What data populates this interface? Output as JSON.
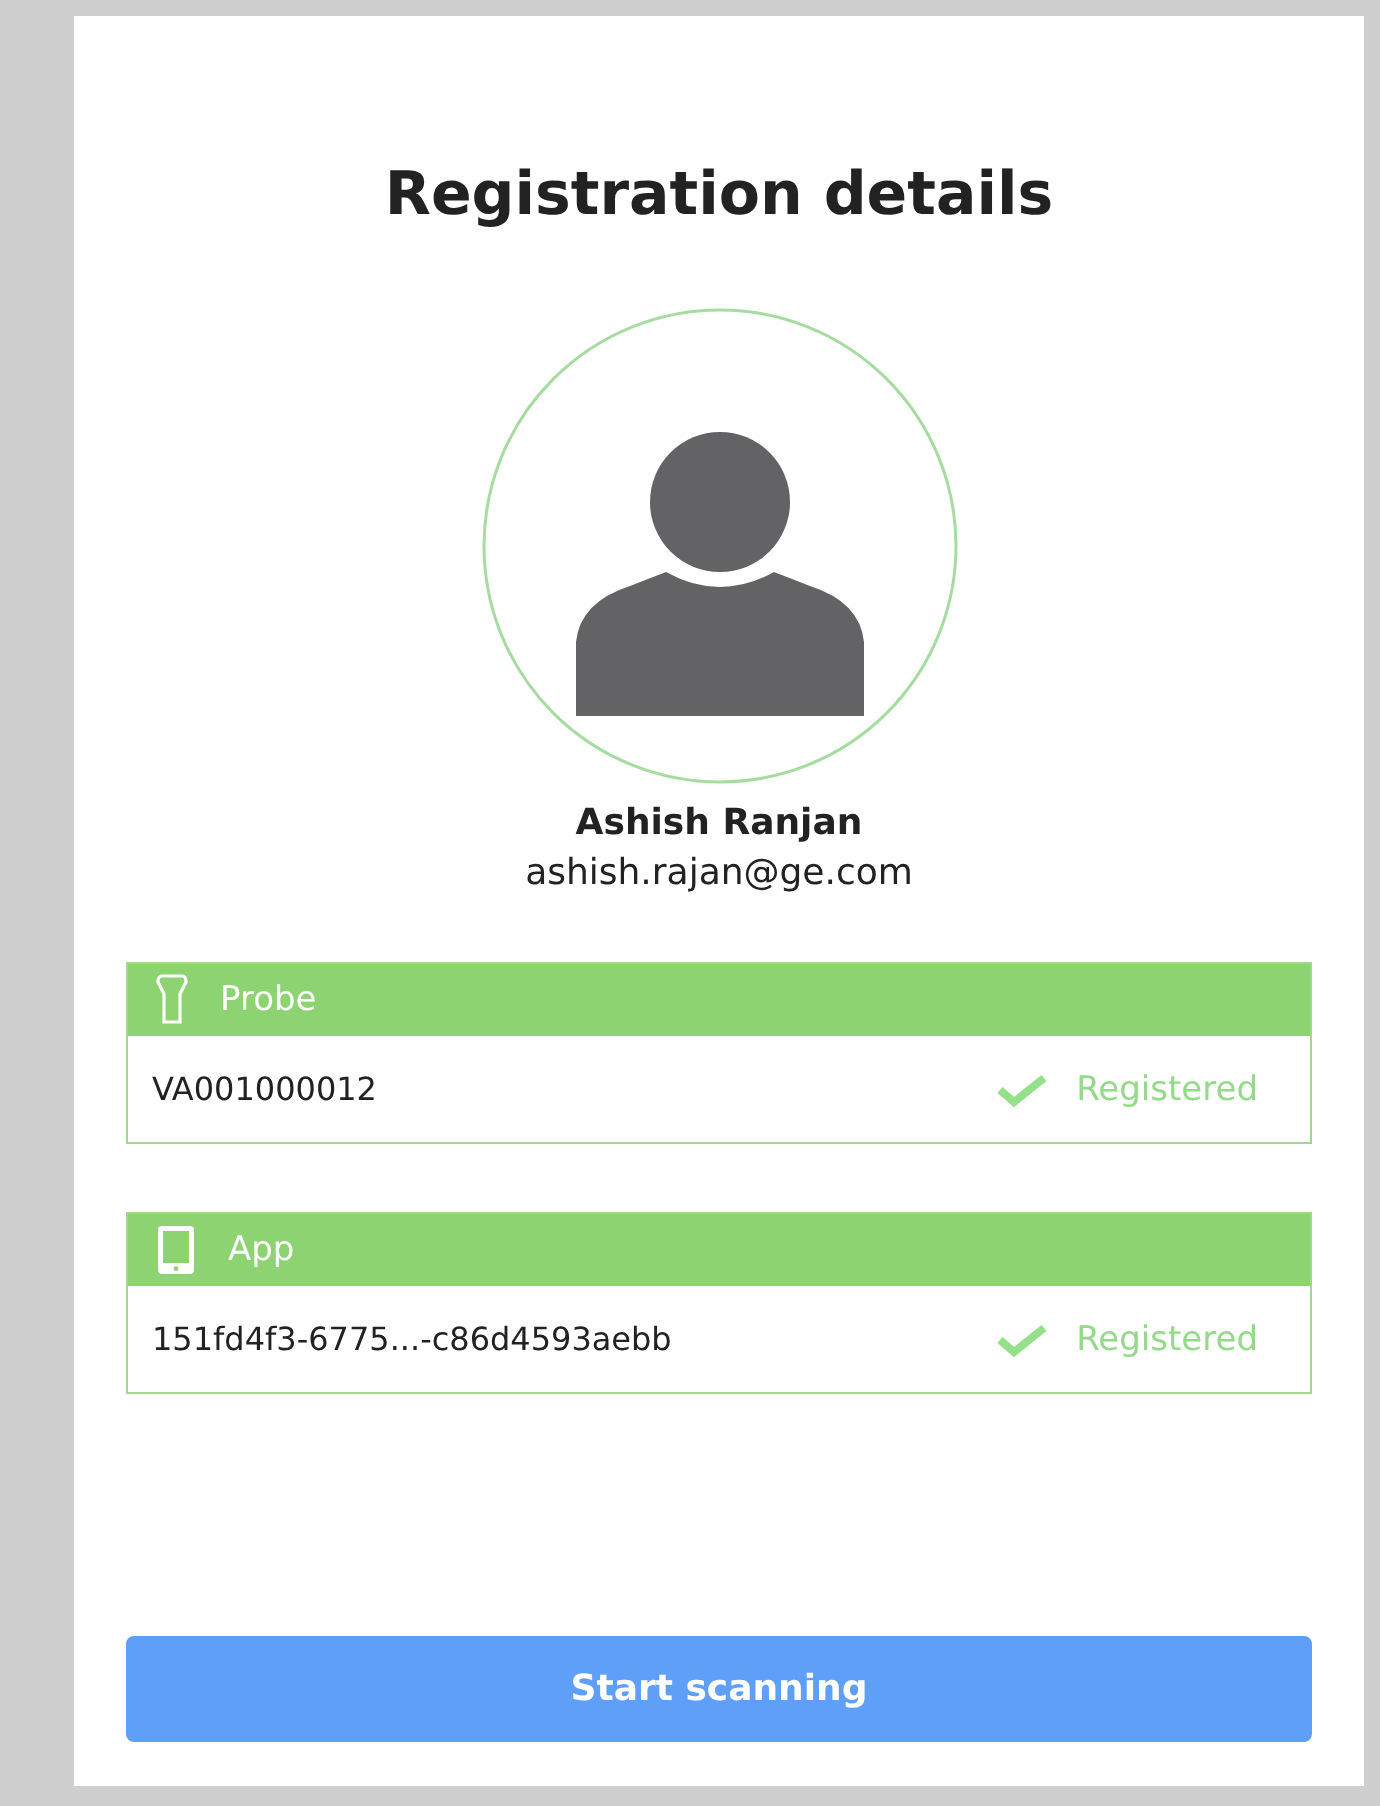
{
  "title": "Registration details",
  "user": {
    "name": "Ashish Ranjan",
    "email": "ashish.rajan@ge.com"
  },
  "devices": [
    {
      "kind": "probe",
      "label": "Probe",
      "id": "VA001000012",
      "registered": true,
      "status": "Registered"
    },
    {
      "kind": "app",
      "label": "App",
      "id": "151fd4f3-6775...-c86d4593aebb",
      "registered": true,
      "status": "Registered"
    }
  ],
  "button": "Start scanning"
}
